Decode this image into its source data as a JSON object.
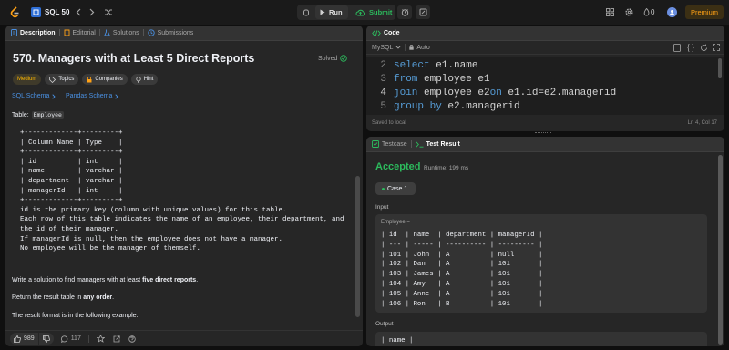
{
  "topbar": {
    "study_plan": "SQL 50",
    "run": "Run",
    "submit": "Submit",
    "streak": "0",
    "premium": "Premium"
  },
  "left": {
    "tabs": [
      "Description",
      "Editorial",
      "Solutions",
      "Submissions"
    ],
    "title": "570. Managers with at Least 5 Direct Reports",
    "status": "Solved",
    "tags": [
      "Medium",
      "Topics",
      "Companies",
      "Hint"
    ],
    "schema_links": [
      "SQL Schema",
      "Pandas Schema"
    ],
    "table_label": "Table:",
    "table_name": "Employee",
    "schema_block": "+-------------+---------+\n| Column Name | Type    |\n+-------------+---------+\n| id          | int     |\n| name        | varchar |\n| department  | varchar |\n| managerId   | int     |\n+-------------+---------+\nid is the primary key (column with unique values) for this table.\nEach row of this table indicates the name of an employee, their department, and\nthe id of their manager.\nIf managerId is null, then the employee does not have a manager.\nNo employee will be the manager of themself.",
    "para1_pre": "Write a solution to find managers with at least ",
    "para1_bold": "five direct reports",
    "para1_post": ".",
    "para2_pre": "Return the result table in ",
    "para2_bold": "any order",
    "para2_post": ".",
    "para3": "The result format is in the following example.",
    "likes": "989",
    "comments": "117"
  },
  "code": {
    "tab": "Code",
    "language": "MySQL",
    "auto": "Auto",
    "lines": [
      {
        "n": "2",
        "kw1": "select",
        "rest1": " e1.name",
        "kw2": "",
        "rest2": ""
      },
      {
        "n": "3",
        "kw1": "from",
        "rest1": " employee e1",
        "kw2": "",
        "rest2": ""
      },
      {
        "n": "4",
        "kw1": "join",
        "rest1": " employee e2",
        "kw2": "on",
        "rest2": " e1.id=e2.managerid"
      },
      {
        "n": "5",
        "kw1": "group by",
        "rest1": " e2.managerid",
        "kw2": "",
        "rest2": ""
      }
    ],
    "saved": "Saved to local",
    "cursor": "Ln 4, Col 17"
  },
  "result": {
    "tabs": [
      "Testcase",
      "Test Result"
    ],
    "status": "Accepted",
    "runtime": "Runtime: 199 ms",
    "case": "Case 1",
    "input_label": "Input",
    "input_table_name": "Employee =",
    "input_table": "| id  | name  | department | managerId |\n| --- | ----- | ---------- | --------- |\n| 101 | John  | A          | null      |\n| 102 | Dan   | A          | 101       |\n| 103 | James | A          | 101       |\n| 104 | Amy   | A          | 101       |\n| 105 | Anne  | A          | 101       |\n| 106 | Ron   | B          | 101       |",
    "output_label": "Output",
    "output_table": "| name |"
  },
  "colors": {
    "accent": "#ffa116",
    "green": "#2cbb5d",
    "blue": "#4a90e2"
  }
}
